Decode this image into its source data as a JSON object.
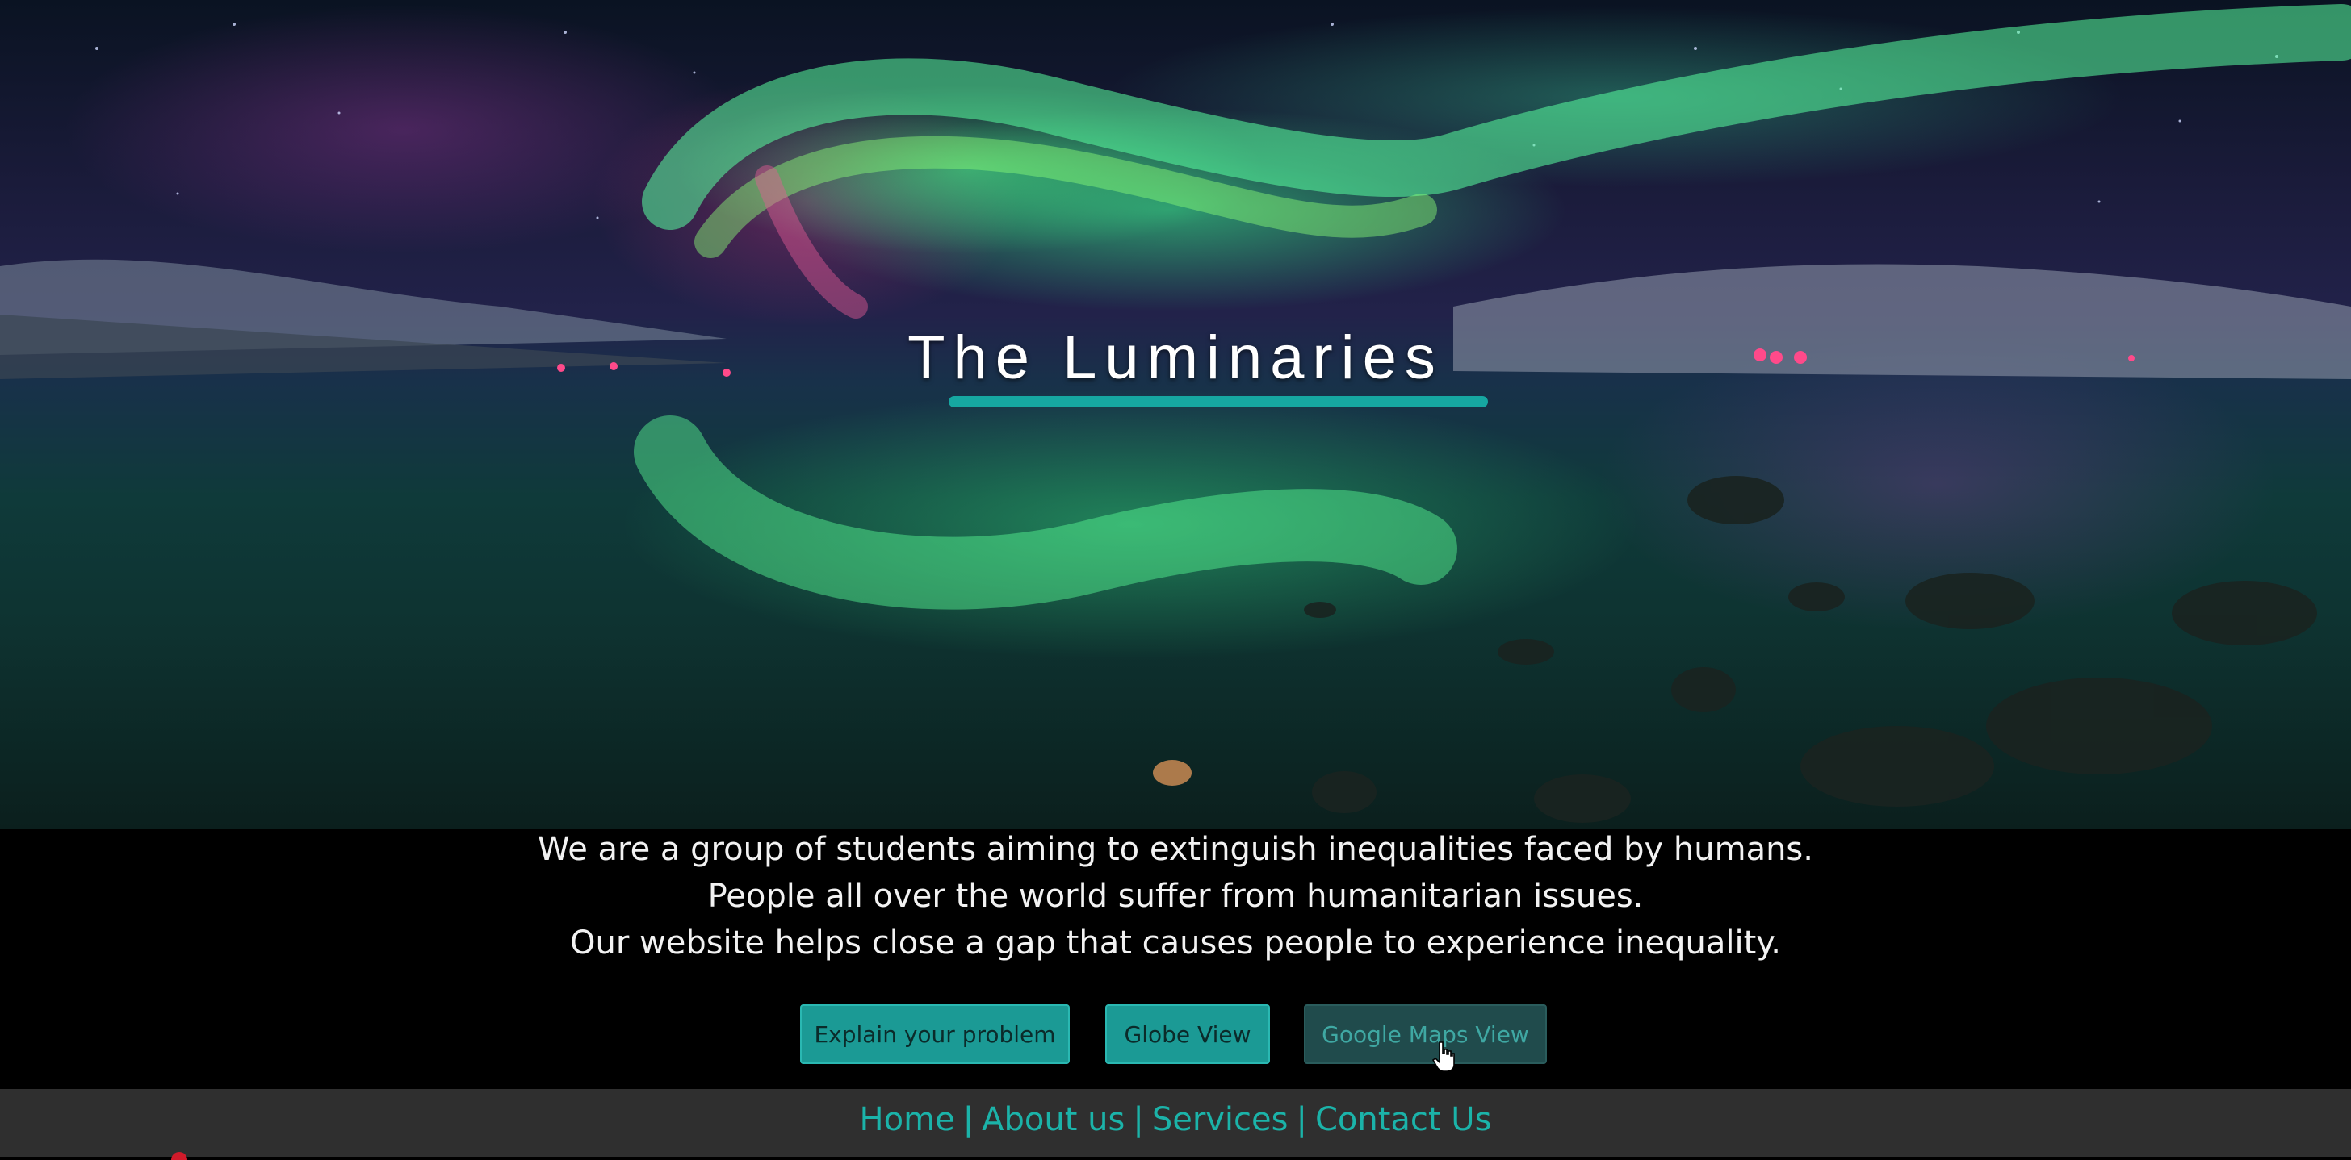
{
  "hero": {
    "title": "The Luminaries"
  },
  "intro": {
    "lines": [
      "We are a group of students aiming to extinguish inequalities faced by humans.",
      "People all over the world suffer from humanitarian issues.",
      "Our website helps close a gap that causes people to experience inequality."
    ]
  },
  "buttons": {
    "explain": "Explain your problem",
    "globe": "Globe View",
    "maps": "Google Maps View"
  },
  "footer": {
    "links": [
      "Home",
      "About us",
      "Services",
      "Contact Us"
    ],
    "separator": "|"
  },
  "colors": {
    "accent": "#1b9a95",
    "footer_link": "#1bb3a9",
    "footer_bg": "#2f2f2f"
  }
}
